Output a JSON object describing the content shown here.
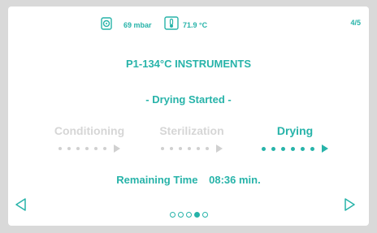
{
  "status_bar": {
    "pressure": "69 mbar",
    "temperature": "71.9 °C",
    "pressure_icon": "pressure-gauge-icon",
    "temperature_icon": "thermometer-icon"
  },
  "page_counter": "4/5",
  "program_title": "P1-134°C INSTRUMENTS",
  "phase_status": "- Drying Started -",
  "steps": [
    {
      "label": "Conditioning",
      "active": false
    },
    {
      "label": "Sterilization",
      "active": false
    },
    {
      "label": "Drying",
      "active": true
    }
  ],
  "remaining": {
    "label": "Remaining Time",
    "value": "08:36 min."
  },
  "pager": {
    "total": 5,
    "current": 4
  },
  "colors": {
    "accent": "#27b3a9",
    "inactive": "#d6d6d6",
    "background": "#ffffff",
    "frame": "#d9d9d9"
  },
  "icons": {
    "prev": "chevron-left-icon",
    "next": "chevron-right-icon"
  }
}
